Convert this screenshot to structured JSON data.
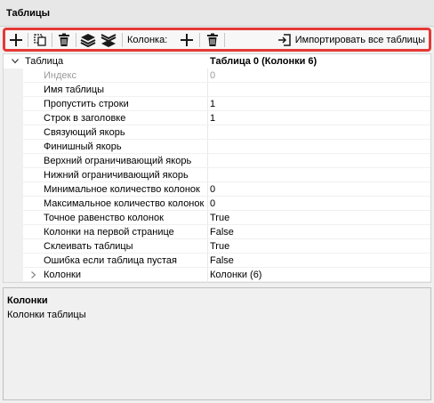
{
  "panel": {
    "title": "Таблицы"
  },
  "toolbar": {
    "column_label": "Колонка:",
    "import_label": "Импортировать все таблицы"
  },
  "grid": {
    "header": {
      "name": "Таблица",
      "value": "Таблица 0 (Колонки 6)"
    },
    "rows": [
      {
        "name": "Индекс",
        "value": "0"
      },
      {
        "name": "Имя таблицы",
        "value": ""
      },
      {
        "name": "Пропустить строки",
        "value": "1"
      },
      {
        "name": "Строк в заголовке",
        "value": "1"
      },
      {
        "name": "Связующий якорь",
        "value": ""
      },
      {
        "name": "Финишный якорь",
        "value": ""
      },
      {
        "name": "Верхний ограничивающий якорь",
        "value": ""
      },
      {
        "name": "Нижний ограничивающий якорь",
        "value": ""
      },
      {
        "name": "Минимальное количество колонок",
        "value": "0"
      },
      {
        "name": "Максимальное количество колонок",
        "value": "0"
      },
      {
        "name": "Точное равенство колонок",
        "value": "True"
      },
      {
        "name": "Колонки на первой странице",
        "value": "False"
      },
      {
        "name": "Склеивать таблицы",
        "value": "True"
      },
      {
        "name": "Ошибка если таблица пустая",
        "value": "False"
      },
      {
        "name": "Колонки",
        "value": "Колонки (6)"
      }
    ]
  },
  "description": {
    "title": "Колонки",
    "text": "Колонки таблицы"
  },
  "colors": {
    "highlight_border": "#e53935"
  }
}
